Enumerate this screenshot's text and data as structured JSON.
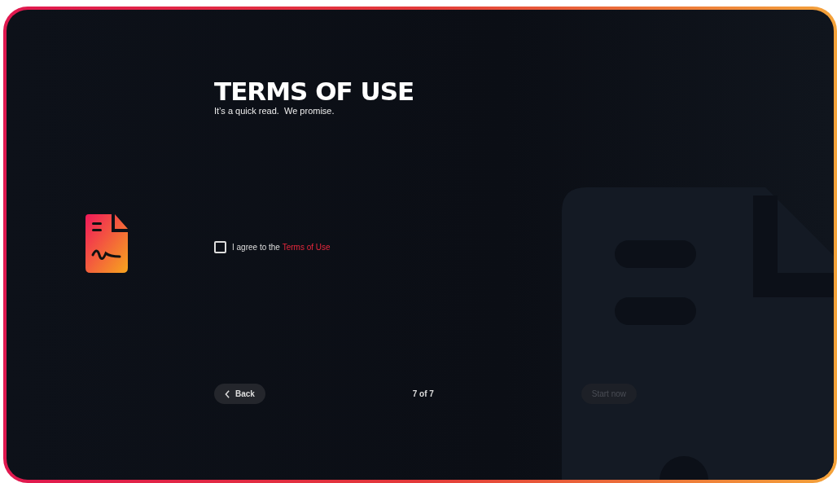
{
  "header": {
    "title": "TERMS OF USE",
    "subtitle": "It’s a quick read.  We promise."
  },
  "agreement": {
    "text": "I agree to the ",
    "link": "Terms of Use",
    "checked": false
  },
  "footer": {
    "back": {
      "label": "Back"
    },
    "progress": "7 of 7",
    "next": {
      "label": "Start now",
      "disabled": true
    }
  }
}
